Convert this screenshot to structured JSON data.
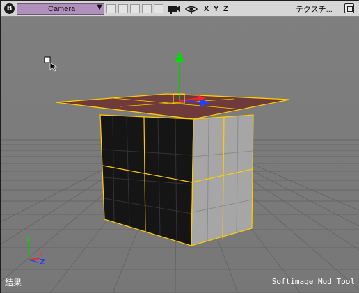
{
  "viewport": {
    "letter": "B",
    "camera": "Camera",
    "axes": [
      "X",
      "Y",
      "Z"
    ],
    "display_mode": "テクスチ...",
    "result_label": "結果",
    "watermark": "Softimage Mod Tool"
  },
  "colors": {
    "toolbar_bg": "#d6d6d6",
    "camera_select": "#b08fbc",
    "viewport_bg": "#7b7b7b",
    "selection_outline": "#ffcc00"
  },
  "icons": [
    "camera-icon",
    "eye-icon",
    "maximize-icon",
    "mouse-cursor-icon"
  ]
}
